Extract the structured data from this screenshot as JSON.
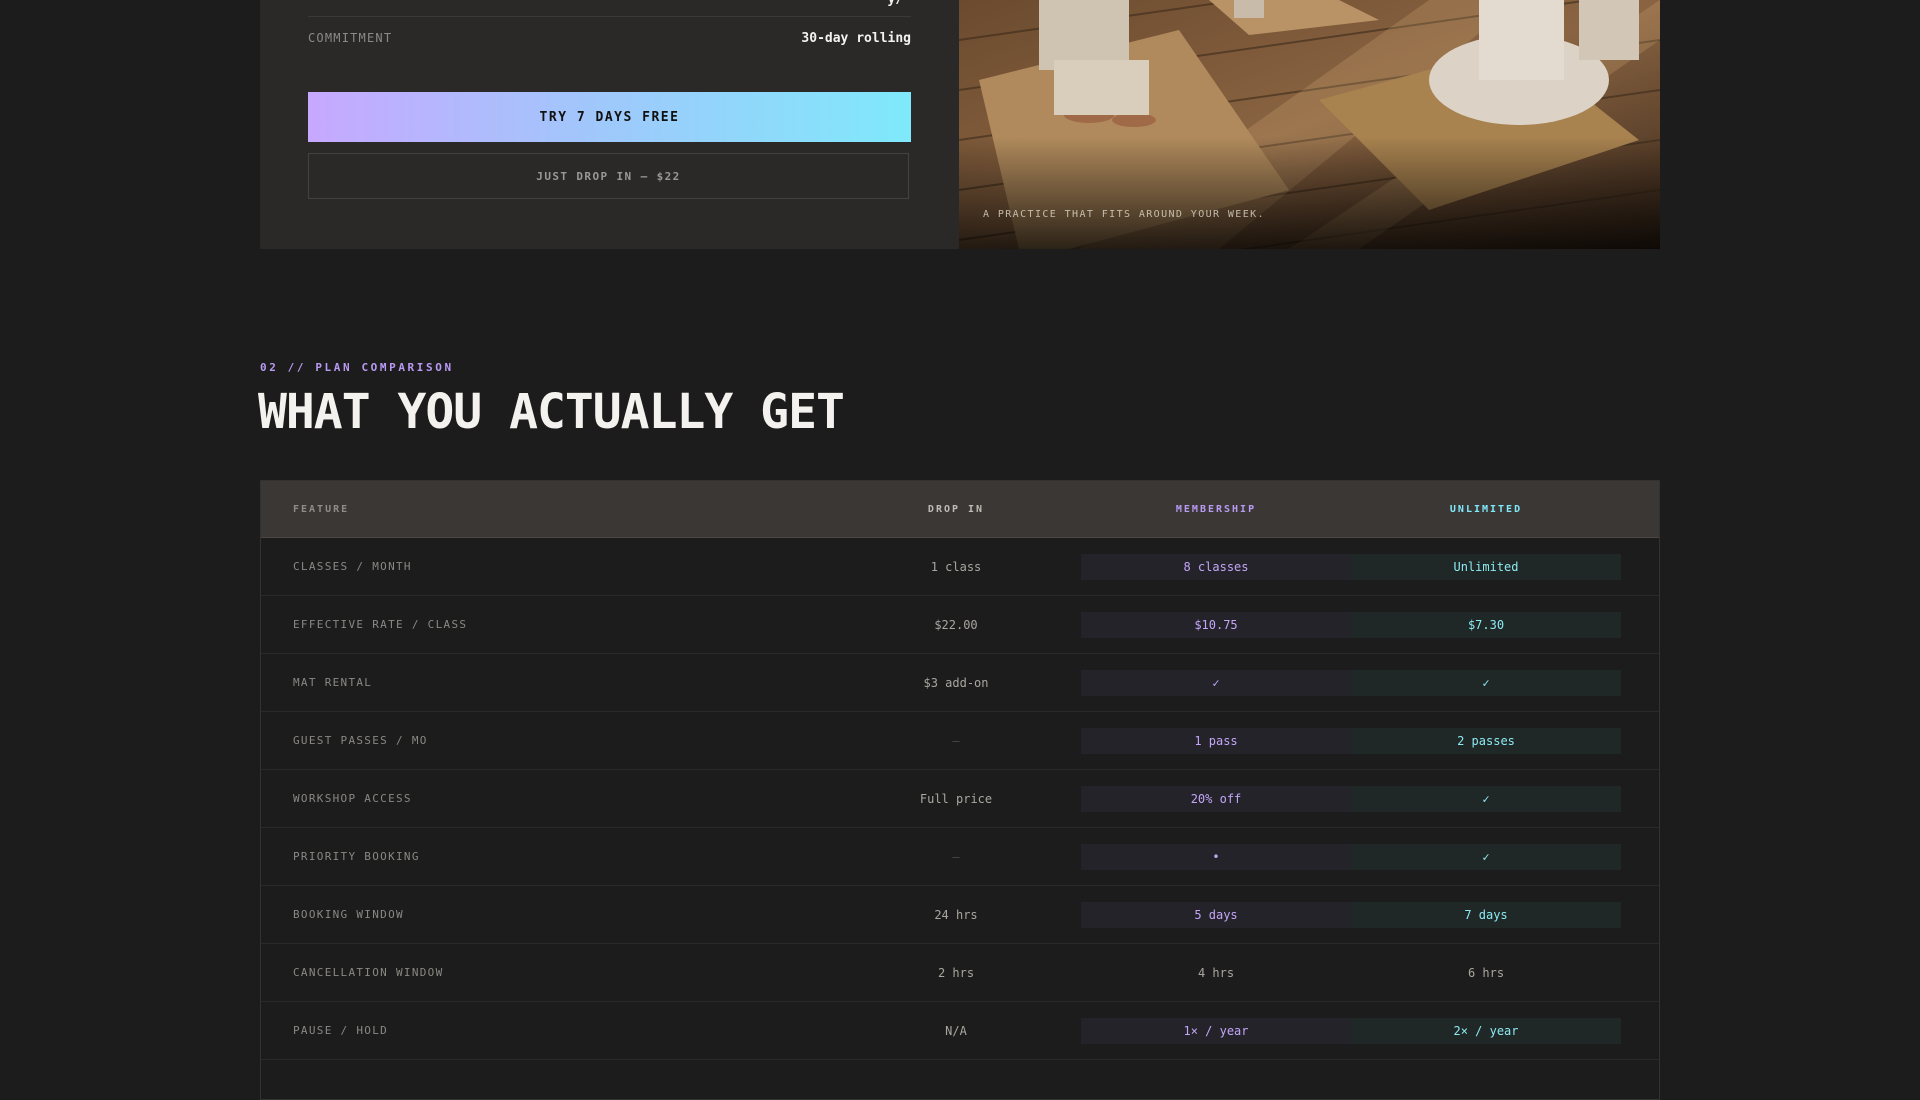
{
  "pricing_card": {
    "commitment_label": "COMMITMENT",
    "commitment_value": "30-day rolling",
    "primary_button": "TRY 7 DAYS FREE",
    "secondary_button": "JUST DROP IN — $22"
  },
  "hero": {
    "caption": "A PRACTICE THAT FITS AROUND YOUR WEEK."
  },
  "section": {
    "eyebrow": "02 // PLAN COMPARISON",
    "title": "WHAT YOU ACTUALLY GET"
  },
  "table": {
    "headers": [
      "FEATURE",
      "DROP IN",
      "MEMBERSHIP",
      "UNLIMITED"
    ],
    "rows": [
      {
        "feature": "CLASSES / MONTH",
        "drop": "1 class",
        "mem": "8 classes",
        "unl": "Unlimited"
      },
      {
        "feature": "EFFECTIVE RATE / CLASS",
        "drop": "$22.00",
        "mem": "$10.75",
        "unl": "$7.30"
      },
      {
        "feature": "MAT RENTAL",
        "drop": "$3 add-on",
        "mem": "✓",
        "unl": "✓"
      },
      {
        "feature": "GUEST PASSES / MO",
        "drop": "—",
        "mem": "1 pass",
        "unl": "2 passes"
      },
      {
        "feature": "WORKSHOP ACCESS",
        "drop": "Full price",
        "mem": "20% off",
        "unl": "✓"
      },
      {
        "feature": "PRIORITY BOOKING",
        "drop": "—",
        "mem": "•",
        "unl": "✓"
      },
      {
        "feature": "BOOKING WINDOW",
        "drop": "24 hrs",
        "mem": "5 days",
        "unl": "7 days"
      },
      {
        "feature": "CANCELLATION WINDOW",
        "drop": "2 hrs",
        "mem": "4 hrs",
        "unl": "6 hrs"
      },
      {
        "feature": "PAUSE / HOLD",
        "drop": "N/A",
        "mem": "1× / year",
        "unl": "2× / year"
      }
    ]
  },
  "colors": {
    "accent_purple": "#b99af3",
    "accent_cyan": "#7fe9fb",
    "background": "#1c1c1c"
  }
}
